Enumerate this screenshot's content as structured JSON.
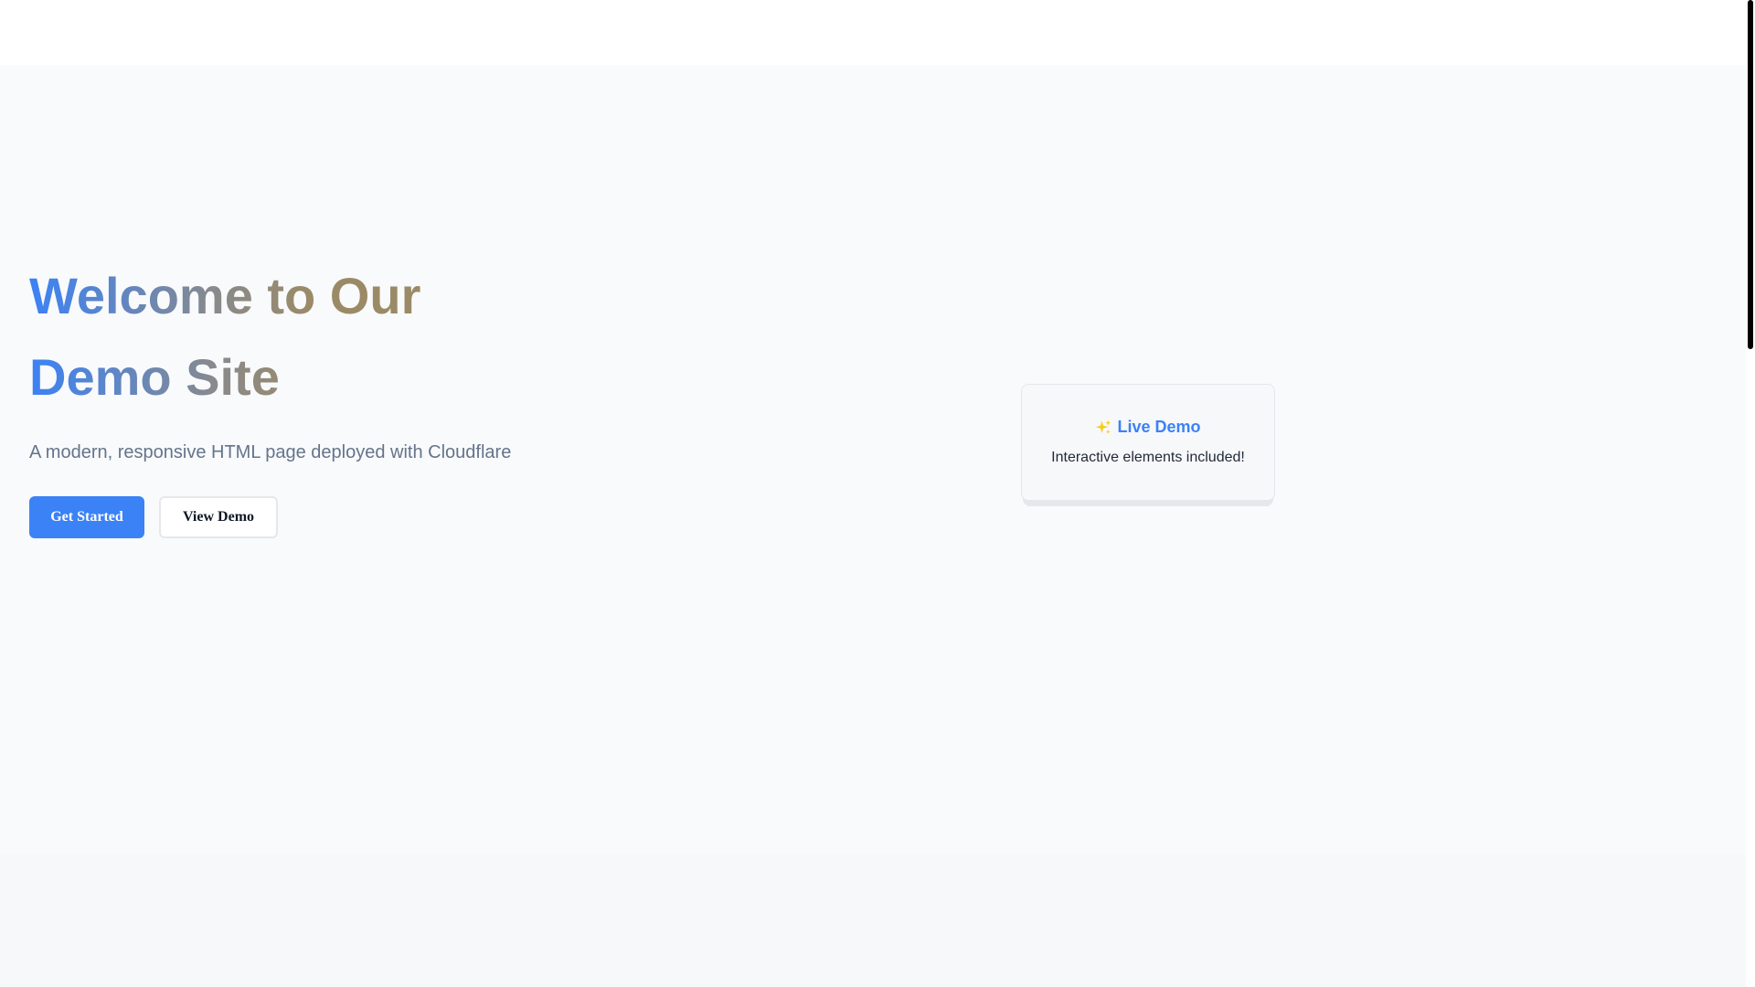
{
  "hero": {
    "title": "Welcome to Our Demo Site",
    "subtitle": "A modern, responsive HTML page deployed with Cloudflare",
    "buttons": {
      "primary_label": "Get Started",
      "secondary_label": "View Demo"
    }
  },
  "demo_card": {
    "icon": "sparkle-icon",
    "title": "Live Demo",
    "text": "Interactive elements included!"
  },
  "colors": {
    "accent": "#3b82f6",
    "sparkle": "#facc15",
    "subtitle": "#64748b"
  }
}
